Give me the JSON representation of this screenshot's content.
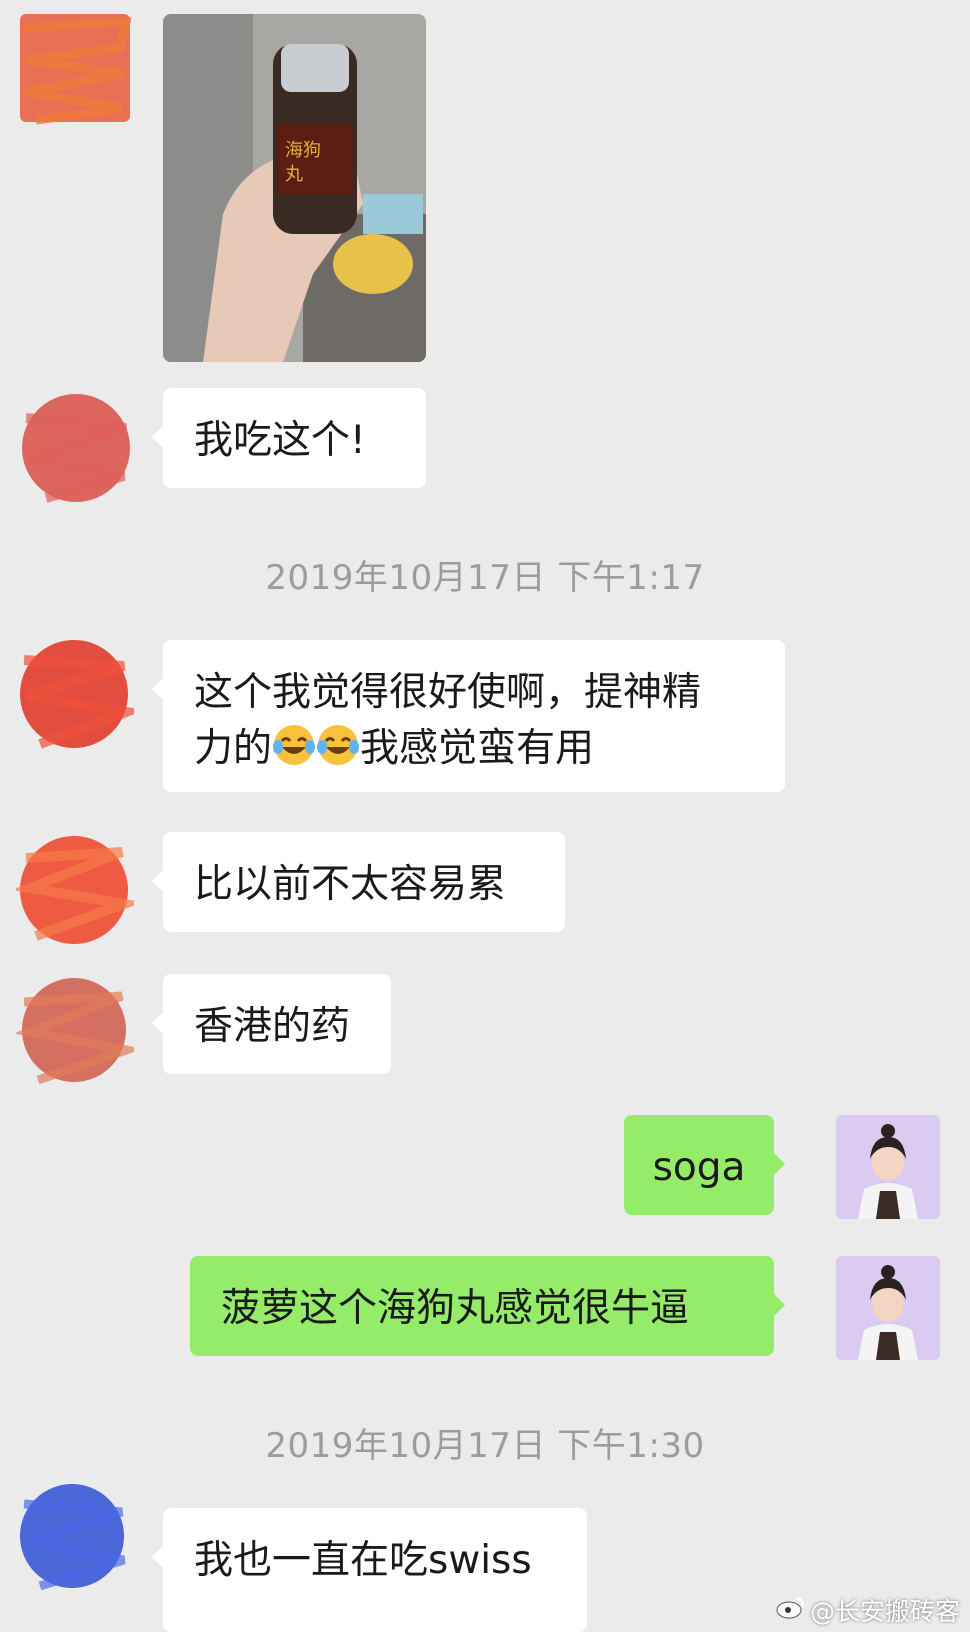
{
  "messages": [
    {
      "text": "我吃这个!"
    },
    {
      "text": "这个我觉得很好使啊，提神精"
    },
    {
      "text_line2_a": "力的",
      "text_line2_b": "我感觉蛮有用"
    },
    {
      "text": "比以前不太容易累"
    },
    {
      "text": "香港的药"
    },
    {
      "text": "soga"
    },
    {
      "text": "菠萝这个海狗丸感觉很牛逼"
    },
    {
      "text": "我也一直在吃swiss"
    }
  ],
  "timestamps": [
    "2019年10月17日 下午1:17",
    "2019年10月17日 下午1:30"
  ],
  "watermark": {
    "text": "@长安搬砖客",
    "icon": "weibo-icon"
  },
  "icons": {
    "emoji": "tears-of-joy-emoji"
  },
  "colors": {
    "background": "#ebebeb",
    "incoming_bubble": "#ffffff",
    "outgoing_bubble": "#95ec69",
    "timestamp": "#9c9c9c"
  }
}
